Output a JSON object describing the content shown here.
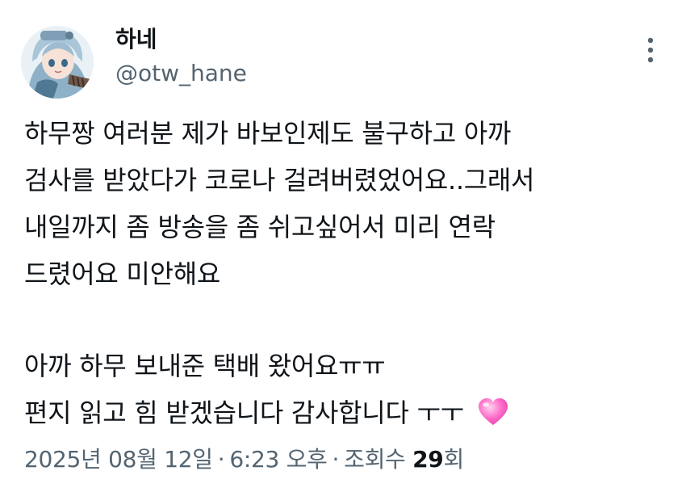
{
  "author": {
    "display_name": "하네",
    "handle": "@otw_hane",
    "avatar_icon": "anime-girl-avatar"
  },
  "more_icon": "more-vertical-icon",
  "tweet": {
    "lines": [
      "하무짱 여러분 제가 바보인제도 불구하고 아까",
      "검사를 받았다가 코로나 걸려버렸었어요..그래서",
      "내일까지 좀 방송을 좀 쉬고싶어서 미리 연락",
      "드렸어요 미안해요",
      "",
      "아까 하무 보내준 택배 왔어요ㅠㅠ",
      "편지 읽고 힘 받겠습니다 감사합니다 ㅜㅜ"
    ],
    "emoji": "pink-heart-icon"
  },
  "meta": {
    "date": "2025년 08월 12일",
    "separator": "·",
    "time": "6:23 오후",
    "views_label": "조회수",
    "views_count": "29",
    "views_suffix": "회"
  },
  "colors": {
    "text": "#0f1419",
    "secondary": "#536471",
    "heart": "#ff5fc1"
  }
}
